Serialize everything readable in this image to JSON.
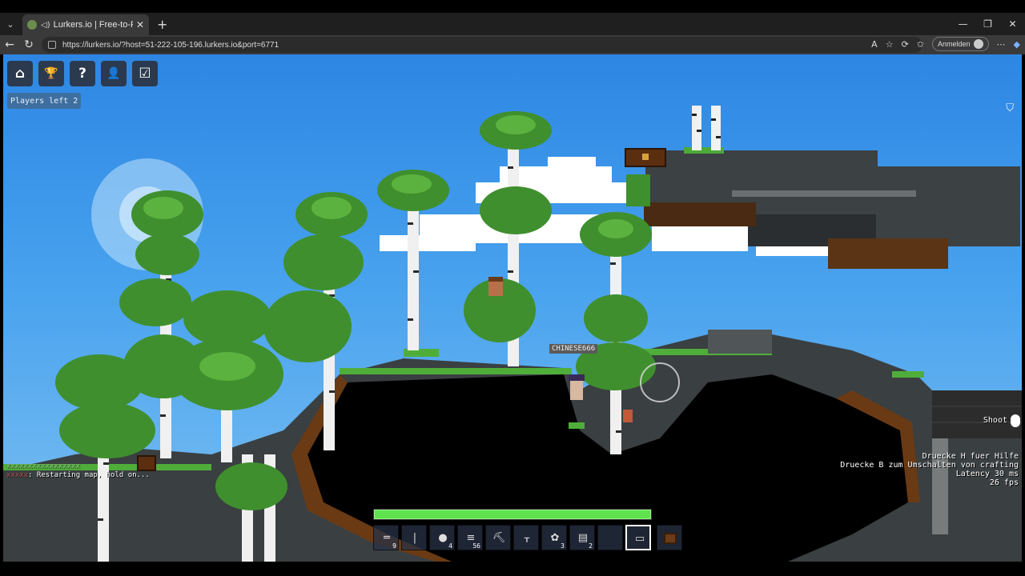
{
  "browser": {
    "tab_title": "Lurkers.io | Free-to-Play Multi",
    "url": "https://lurkers.io/?host=51-222-105-196.lurkers.io&port=6771",
    "login_label": "Anmelden"
  },
  "game": {
    "menu_buttons": [
      {
        "name": "home-button",
        "icon": "home-icon",
        "glyph": "⌂"
      },
      {
        "name": "leaderboard-button",
        "icon": "trophy-icon",
        "glyph": "🏆"
      },
      {
        "name": "help-button",
        "icon": "question-icon",
        "glyph": "?"
      },
      {
        "name": "profile-button",
        "icon": "user-icon",
        "glyph": "👤"
      },
      {
        "name": "tasks-button",
        "icon": "checklist-icon",
        "glyph": "☑"
      }
    ],
    "players_left": "Players left 2",
    "player_name": "CHINESE666",
    "chat": {
      "line1": "xxxxxxxxxxxxxxxxx",
      "line2_prefix": "xxxxx",
      "line2": ": Restarting map, hold on..."
    },
    "hud": {
      "shoot_label": "Shoot",
      "help_line1": "Druecke H fuer Hilfe",
      "help_line2": "Druecke B zum Umschalten von crafting",
      "latency": "Latency 30 ms",
      "fps": "26 fps"
    },
    "health_fraction": 1.0,
    "hotbar": [
      {
        "icon": "rifle-icon",
        "glyph": "═",
        "count": "9"
      },
      {
        "icon": "sword-icon",
        "glyph": "|",
        "count": ""
      },
      {
        "icon": "meat-icon",
        "glyph": "●",
        "count": "4"
      },
      {
        "icon": "wood-icon",
        "glyph": "≡",
        "count": "56"
      },
      {
        "icon": "pickaxe-icon",
        "glyph": "⛏",
        "count": ""
      },
      {
        "icon": "axe-icon",
        "glyph": "ᚁ",
        "count": ""
      },
      {
        "icon": "leaf-icon",
        "glyph": "✿",
        "count": "3"
      },
      {
        "icon": "planks-icon",
        "glyph": "▤",
        "count": "2"
      },
      {
        "icon": "empty-slot",
        "glyph": "",
        "count": ""
      },
      {
        "icon": "launcher-icon",
        "glyph": "▭",
        "count": ""
      }
    ],
    "colors": {
      "health": "#5fe34e",
      "sky": "#48a2ee"
    }
  }
}
